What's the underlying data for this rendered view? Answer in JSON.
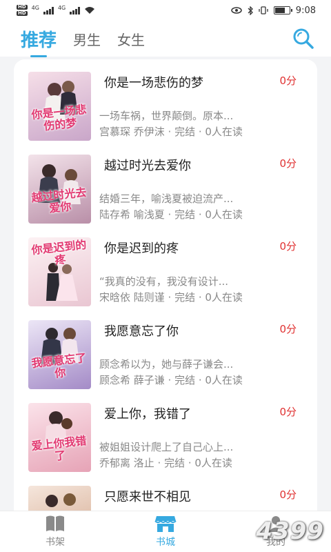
{
  "status_bar": {
    "hd1": "HD",
    "hd2": "HD",
    "net1": "4G",
    "net2": "4G",
    "time": "9:08"
  },
  "top_nav": {
    "tabs": [
      {
        "label": "推荐",
        "active": true
      },
      {
        "label": "男生",
        "active": false
      },
      {
        "label": "女生",
        "active": false
      }
    ],
    "search_icon": "search-icon",
    "accent": "#36a9e0"
  },
  "books": [
    {
      "title": "你是一场悲伤的梦",
      "score": "0分",
      "desc": "一场车祸，世界颠倒。原本...",
      "meta": "宫慕琛 乔伊沫 · 完结 · 0人在读",
      "cover_text": "你是一场悲伤的梦",
      "cover_colors": [
        "#f6dfe8",
        "#c9a6c9"
      ]
    },
    {
      "title": "越过时光去爱你",
      "score": "0分",
      "desc": "结婚三年，喻浅夏被迫流产...",
      "meta": "陆存希 喻浅夏 · 完结 · 0人在读",
      "cover_text": "越过时光去爱你",
      "cover_colors": [
        "#f3e3ea",
        "#b98fa8"
      ]
    },
    {
      "title": "你是迟到的疼",
      "score": "0分",
      "desc": "“我真的没有，我没有设计...",
      "meta": "宋晗依 陆则谨 · 完结 · 0人在读",
      "cover_text": "你是迟到的疼",
      "cover_colors": [
        "#fdf2f4",
        "#e9c6d2"
      ]
    },
    {
      "title": "我愿意忘了你",
      "score": "0分",
      "desc": "顾念希以为，她与薛子谦会...",
      "meta": "顾念希 薛子谦 · 完结 · 0人在读",
      "cover_text": "我愿意忘了你",
      "cover_colors": [
        "#ece6f6",
        "#a48bc7"
      ]
    },
    {
      "title": "爱上你，我错了",
      "score": "0分",
      "desc": "被姐姐设计爬上了自己心上...",
      "meta": "乔郁离 洛止 · 完结 · 0人在读",
      "cover_text": "爱上你我错了",
      "cover_colors": [
        "#fbe3ea",
        "#e6a3b6"
      ]
    },
    {
      "title": "只愿来世不相见",
      "score": "0分",
      "desc": "",
      "meta": "",
      "cover_text": "",
      "cover_colors": [
        "#f5e6dc",
        "#d2a58a"
      ]
    }
  ],
  "bottom_nav": {
    "items": [
      {
        "label": "书架",
        "icon": "bookshelf-icon",
        "active": false
      },
      {
        "label": "书城",
        "icon": "bookstore-icon",
        "active": true
      },
      {
        "label": "我的",
        "icon": "profile-icon",
        "active": false
      }
    ]
  },
  "watermark": "4399"
}
